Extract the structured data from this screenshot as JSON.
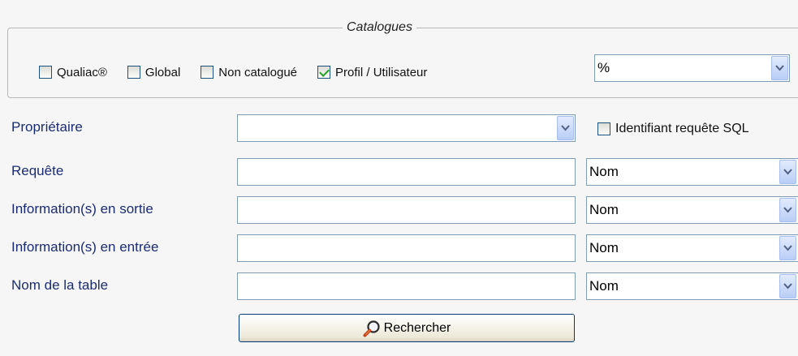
{
  "catalogues": {
    "legend": "Catalogues",
    "options": [
      {
        "label": "Qualiac®",
        "checked": false
      },
      {
        "label": "Global",
        "checked": false
      },
      {
        "label": "Non catalogué",
        "checked": false
      },
      {
        "label": "Profil / Utilisateur",
        "checked": true
      }
    ],
    "profile_select_value": "%"
  },
  "form": {
    "owner_label": "Propriétaire",
    "owner_value": "",
    "sql_id_label": "Identifiant requête SQL",
    "sql_id_checked": false,
    "rows": [
      {
        "label": "Requête",
        "value": "",
        "mode": "Nom"
      },
      {
        "label": "Information(s) en sortie",
        "value": "",
        "mode": "Nom"
      },
      {
        "label": "Information(s) en entrée",
        "value": "",
        "mode": "Nom"
      },
      {
        "label": "Nom de la table",
        "value": "",
        "mode": "Nom"
      }
    ]
  },
  "search_button_label": "Rechercher",
  "icons": {
    "dropdown": "chevron-down-icon",
    "search": "magnifier-icon"
  }
}
